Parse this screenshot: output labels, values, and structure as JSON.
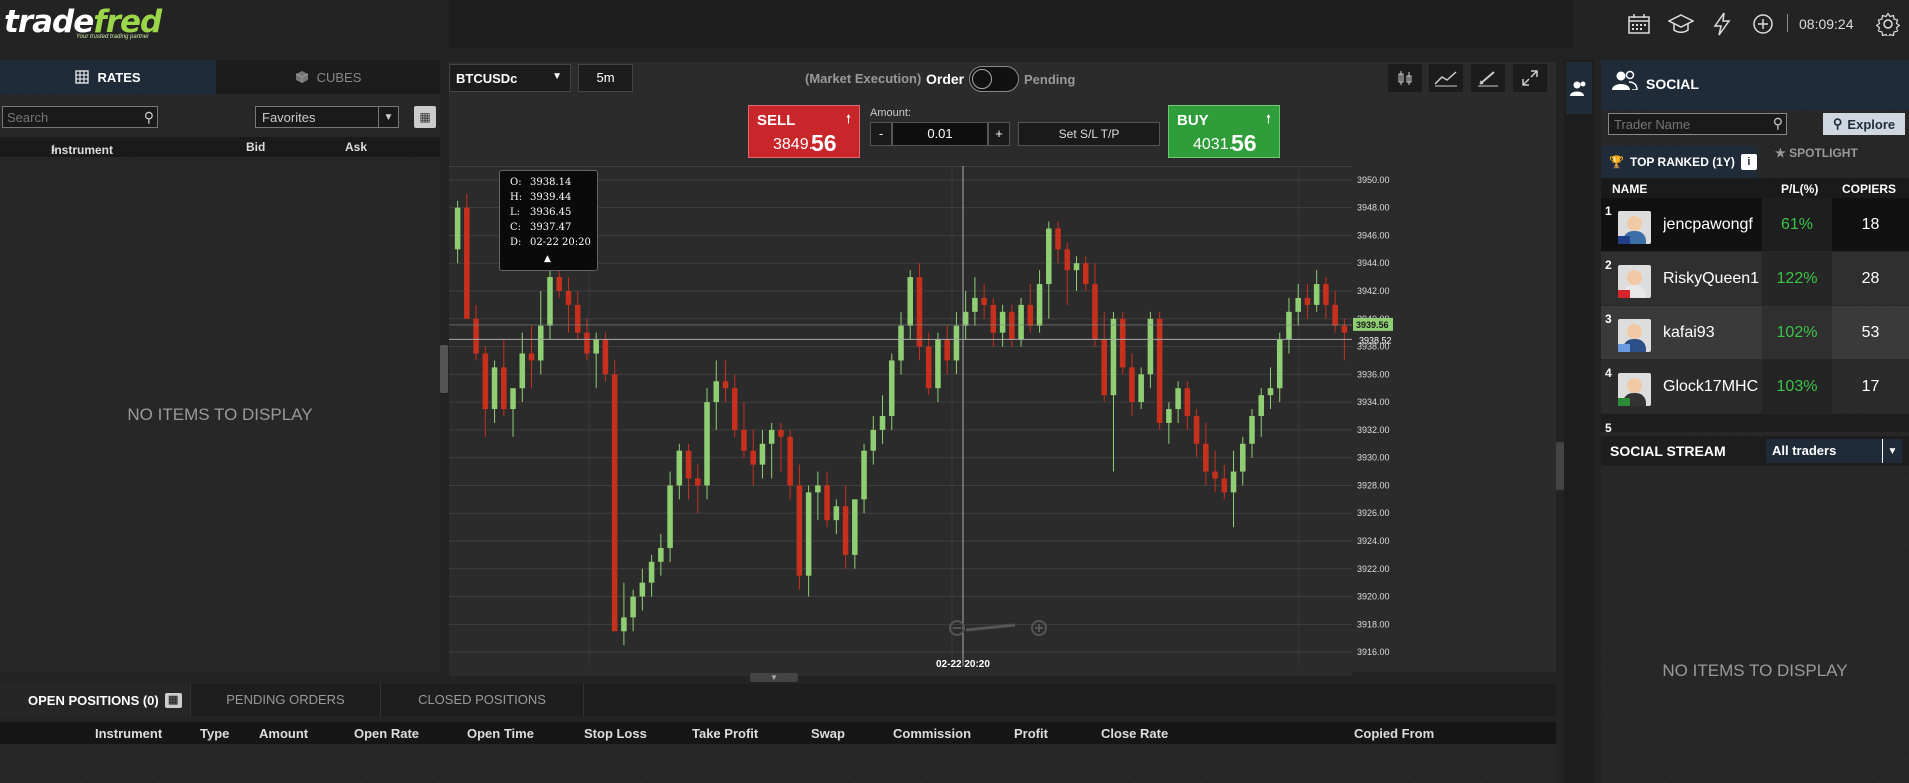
{
  "brand": {
    "logo_part1": "trade",
    "logo_part2": "fred",
    "tagline": "Your trusted trading partner"
  },
  "topbar": {
    "clock": "08:09:24",
    "icons": [
      "calendar-icon",
      "education-icon",
      "lightning-icon",
      "plus-circle-icon",
      "settings-gear-icon"
    ]
  },
  "left": {
    "tabs": {
      "rates": "RATES",
      "cubes": "CUBES"
    },
    "search_placeholder": "Search",
    "filter_selected": "Favorites",
    "columns": {
      "instrument": "Instrument",
      "bid": "Bid",
      "ask": "Ask"
    },
    "empty": "NO ITEMS TO DISPLAY"
  },
  "chart_toolbar": {
    "symbol": "BTCUSDc",
    "timeframe": "5m",
    "market_execution": "(Market Execution)",
    "order": "Order",
    "pending": "Pending"
  },
  "trade": {
    "sell_label": "SELL",
    "sell_price_main": "3849.",
    "sell_price_big": "56",
    "buy_label": "BUY",
    "buy_price_main": "4031.",
    "buy_price_big": "56",
    "amount_label": "Amount:",
    "amount_minus": "-",
    "amount_value": "0.01",
    "amount_plus": "+",
    "sltp": "Set S/L T/P"
  },
  "tooltip": {
    "o_label": "O:",
    "o": "3938.14",
    "h_label": "H:",
    "h": "3939.44",
    "l_label": "L:",
    "l": "3936.45",
    "c_label": "C:",
    "c": "3937.47",
    "d_label": "D:",
    "d": "02-22 20:20"
  },
  "chart_data": {
    "type": "candlestick",
    "ylim": [
      3915,
      3951
    ],
    "yticks": [
      "3950.00",
      "3948.00",
      "3946.00",
      "3944.00",
      "3942.00",
      "3940.00",
      "3938.00",
      "3936.00",
      "3934.00",
      "3932.00",
      "3930.00",
      "3928.00",
      "3926.00",
      "3924.00",
      "3922.00",
      "3920.00",
      "3918.00",
      "3916.00"
    ],
    "current_price_label": "3939.56",
    "crosshair_price_label": "3938.52",
    "crosshair_time_label": "02-22 20:20",
    "colors": {
      "up": "#8fce72",
      "down": "#c8301e",
      "grid": "#3f3f3f"
    },
    "candles": [
      [
        3945.0,
        3948.5,
        3944.0,
        3948.0
      ],
      [
        3948.0,
        3949.0,
        3940.0,
        3940.0
      ],
      [
        3940.0,
        3941.0,
        3937.0,
        3937.5
      ],
      [
        3937.5,
        3938.0,
        3931.5,
        3933.5
      ],
      [
        3933.5,
        3937.0,
        3932.5,
        3936.5
      ],
      [
        3936.5,
        3938.5,
        3933.0,
        3933.5
      ],
      [
        3933.5,
        3935.0,
        3931.5,
        3935.0
      ],
      [
        3935.0,
        3939.0,
        3934.0,
        3937.5
      ],
      [
        3937.5,
        3939.5,
        3935.0,
        3937.0
      ],
      [
        3937.0,
        3942.0,
        3936.0,
        3939.5
      ],
      [
        3939.5,
        3944.0,
        3938.5,
        3943.0
      ],
      [
        3943.0,
        3944.5,
        3941.5,
        3942.0
      ],
      [
        3942.0,
        3943.0,
        3939.0,
        3941.0
      ],
      [
        3941.0,
        3942.0,
        3938.5,
        3939.0
      ],
      [
        3939.0,
        3940.0,
        3937.0,
        3937.5
      ],
      [
        3937.5,
        3939.0,
        3935.0,
        3938.5
      ],
      [
        3938.5,
        3939.0,
        3935.5,
        3936.0
      ],
      [
        3936.0,
        3937.0,
        3917.5,
        3917.5
      ],
      [
        3917.5,
        3921.0,
        3916.5,
        3918.5
      ],
      [
        3918.5,
        3920.5,
        3917.5,
        3920.0
      ],
      [
        3920.0,
        3922.0,
        3919.0,
        3921.0
      ],
      [
        3921.0,
        3923.0,
        3920.0,
        3922.5
      ],
      [
        3922.5,
        3924.5,
        3921.5,
        3923.5
      ],
      [
        3923.5,
        3929.0,
        3922.5,
        3928.0
      ],
      [
        3928.0,
        3931.0,
        3927.0,
        3930.5
      ],
      [
        3930.5,
        3931.0,
        3927.0,
        3928.5
      ],
      [
        3928.5,
        3929.5,
        3926.0,
        3928.0
      ],
      [
        3928.0,
        3935.0,
        3927.0,
        3934.0
      ],
      [
        3934.0,
        3937.0,
        3932.0,
        3935.5
      ],
      [
        3935.5,
        3937.0,
        3934.0,
        3935.0
      ],
      [
        3935.0,
        3936.0,
        3931.5,
        3932.0
      ],
      [
        3932.0,
        3934.0,
        3930.0,
        3930.5
      ],
      [
        3930.5,
        3932.0,
        3928.0,
        3929.5
      ],
      [
        3929.5,
        3932.0,
        3928.5,
        3931.0
      ],
      [
        3931.0,
        3932.5,
        3928.5,
        3932.0
      ],
      [
        3932.0,
        3932.5,
        3929.0,
        3931.5
      ],
      [
        3931.5,
        3932.0,
        3927.0,
        3928.0
      ],
      [
        3928.0,
        3929.5,
        3920.5,
        3921.5
      ],
      [
        3921.5,
        3928.0,
        3920.0,
        3927.5
      ],
      [
        3927.5,
        3929.0,
        3925.5,
        3928.0
      ],
      [
        3928.0,
        3929.0,
        3925.0,
        3925.5
      ],
      [
        3925.5,
        3927.0,
        3924.5,
        3926.5
      ],
      [
        3926.5,
        3928.0,
        3922.0,
        3923.0
      ],
      [
        3923.0,
        3927.0,
        3922.0,
        3927.0
      ],
      [
        3927.0,
        3931.0,
        3926.0,
        3930.5
      ],
      [
        3930.5,
        3933.0,
        3929.5,
        3932.0
      ],
      [
        3932.0,
        3934.5,
        3931.0,
        3933.0
      ],
      [
        3933.0,
        3937.5,
        3932.0,
        3937.0
      ],
      [
        3937.0,
        3940.5,
        3936.0,
        3939.5
      ],
      [
        3939.5,
        3943.5,
        3938.5,
        3943.0
      ],
      [
        3943.0,
        3944.0,
        3937.0,
        3938.0
      ],
      [
        3938.0,
        3939.0,
        3934.5,
        3935.0
      ],
      [
        3935.0,
        3939.0,
        3934.0,
        3938.5
      ],
      [
        3938.5,
        3939.5,
        3936.0,
        3937.0
      ],
      [
        3937.0,
        3940.5,
        3936.0,
        3939.5
      ],
      [
        3939.5,
        3942.0,
        3938.5,
        3940.5
      ],
      [
        3940.5,
        3943.0,
        3939.5,
        3941.5
      ],
      [
        3941.5,
        3942.5,
        3940.0,
        3941.0
      ],
      [
        3941.0,
        3941.5,
        3938.0,
        3939.0
      ],
      [
        3939.0,
        3941.0,
        3938.0,
        3940.5
      ],
      [
        3940.5,
        3941.0,
        3938.0,
        3938.5
      ],
      [
        3938.5,
        3941.5,
        3938.0,
        3941.0
      ],
      [
        3941.0,
        3942.5,
        3939.0,
        3939.5
      ],
      [
        3939.5,
        3943.5,
        3939.0,
        3942.5
      ],
      [
        3942.5,
        3947.0,
        3940.0,
        3946.5
      ],
      [
        3946.5,
        3947.0,
        3944.0,
        3945.0
      ],
      [
        3945.0,
        3945.5,
        3941.0,
        3943.5
      ],
      [
        3943.5,
        3944.5,
        3942.0,
        3944.0
      ],
      [
        3944.0,
        3944.5,
        3942.0,
        3942.5
      ],
      [
        3942.5,
        3944.0,
        3938.0,
        3938.5
      ],
      [
        3938.5,
        3940.5,
        3934.0,
        3934.5
      ],
      [
        3934.5,
        3940.5,
        3929.0,
        3940.0
      ],
      [
        3940.0,
        3940.5,
        3936.0,
        3936.5
      ],
      [
        3936.5,
        3937.5,
        3933.0,
        3934.0
      ],
      [
        3934.0,
        3936.5,
        3933.5,
        3936.0
      ],
      [
        3936.0,
        3940.5,
        3935.0,
        3940.0
      ],
      [
        3940.0,
        3940.5,
        3932.0,
        3932.5
      ],
      [
        3932.5,
        3934.0,
        3931.0,
        3933.5
      ],
      [
        3933.5,
        3935.5,
        3932.5,
        3935.0
      ],
      [
        3935.0,
        3935.5,
        3932.0,
        3933.0
      ],
      [
        3933.0,
        3933.5,
        3930.0,
        3931.0
      ],
      [
        3931.0,
        3932.5,
        3928.0,
        3929.0
      ],
      [
        3929.0,
        3930.5,
        3927.5,
        3928.5
      ],
      [
        3928.5,
        3929.5,
        3927.0,
        3927.5
      ],
      [
        3927.5,
        3930.5,
        3925.0,
        3929.0
      ],
      [
        3929.0,
        3931.5,
        3928.0,
        3931.0
      ],
      [
        3931.0,
        3933.5,
        3930.0,
        3933.0
      ],
      [
        3933.0,
        3935.0,
        3931.5,
        3934.5
      ],
      [
        3934.5,
        3936.5,
        3933.5,
        3935.0
      ],
      [
        3935.0,
        3939.0,
        3934.0,
        3938.5
      ],
      [
        3938.5,
        3941.5,
        3937.5,
        3940.5
      ],
      [
        3940.5,
        3942.5,
        3939.5,
        3941.5
      ],
      [
        3941.5,
        3942.5,
        3940.0,
        3941.0
      ],
      [
        3941.0,
        3943.5,
        3940.5,
        3942.5
      ],
      [
        3942.5,
        3943.0,
        3940.0,
        3941.0
      ],
      [
        3941.0,
        3942.0,
        3939.0,
        3939.5
      ],
      [
        3939.5,
        3940.0,
        3937.0,
        3939.0
      ]
    ]
  },
  "chart_tools": [
    "candles-chart-icon",
    "line-chart-icon",
    "draw-tool-icon",
    "fullscreen-icon"
  ],
  "positions": {
    "tab_open": "OPEN POSITIONS (0)",
    "tab_pending": "PENDING ORDERS",
    "tab_closed": "CLOSED POSITIONS",
    "columns": [
      "Instrument",
      "Type",
      "Amount",
      "Open Rate",
      "Open Time",
      "Stop Loss",
      "Take Profit",
      "Swap",
      "Commission",
      "Profit",
      "Close Rate",
      "Copied From"
    ]
  },
  "social": {
    "title": "SOCIAL",
    "search_placeholder": "Trader Name",
    "explore": "Explore",
    "tab_top": "TOP RANKED (1Y)",
    "tab_spotlight": "SPOTLIGHT",
    "col_name": "NAME",
    "col_pl": "P/L(%)",
    "col_copiers": "COPIERS",
    "rows": [
      {
        "rank": "1",
        "name": "jencpawongf",
        "pl": "61%",
        "copiers": "18"
      },
      {
        "rank": "2",
        "name": "RiskyQueen1",
        "pl": "122%",
        "copiers": "28"
      },
      {
        "rank": "3",
        "name": "kafai93",
        "pl": "102%",
        "copiers": "53"
      },
      {
        "rank": "4",
        "name": "Glock17MHC",
        "pl": "103%",
        "copiers": "17"
      },
      {
        "rank": "5"
      }
    ],
    "stream_title": "SOCIAL STREAM",
    "stream_filter": "All traders",
    "empty": "NO ITEMS TO DISPLAY"
  }
}
